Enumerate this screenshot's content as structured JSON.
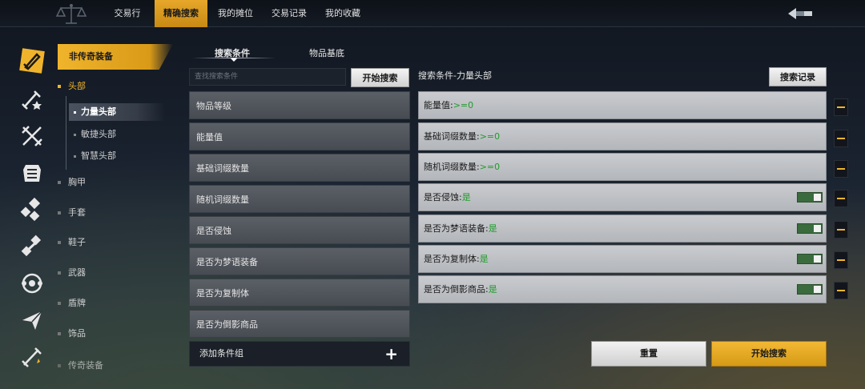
{
  "nav": {
    "tabs": [
      {
        "label": "交易行"
      },
      {
        "label": "精确搜索"
      },
      {
        "label": "我的摊位"
      },
      {
        "label": "交易记录"
      },
      {
        "label": "我的收藏"
      }
    ],
    "active_index": 1
  },
  "rail_icons": [
    "sword-shield-icon",
    "star-sword-icon",
    "crossed-swords-icon",
    "armor-icon",
    "gem-cluster-icon",
    "gem-cross-icon",
    "orb-ring-icon",
    "paper-plane-icon",
    "legendary-sword-icon"
  ],
  "categories": {
    "header": "非传奇装备",
    "items": [
      {
        "label": "头部",
        "active": true
      },
      {
        "label": "胸甲"
      },
      {
        "label": "手套"
      },
      {
        "label": "鞋子"
      },
      {
        "label": "武器"
      },
      {
        "label": "盾牌"
      },
      {
        "label": "饰品"
      },
      {
        "label": "传奇装备"
      }
    ],
    "sub_items": [
      {
        "label": "力量头部",
        "active": true
      },
      {
        "label": "敏捷头部"
      },
      {
        "label": "智慧头部"
      }
    ]
  },
  "tabs": {
    "search_conditions": "搜索条件",
    "item_base": "物品基底"
  },
  "search": {
    "placeholder": "查找搜索条件",
    "start_button": "开始搜索"
  },
  "conditions": [
    "物品等级",
    "能量值",
    "基础词缀数量",
    "随机词缀数量",
    "是否侵蚀",
    "是否为梦语装备",
    "是否为复制体",
    "是否为倒影商品"
  ],
  "add_group_label": "添加条件组",
  "right_panel": {
    "title": "搜索条件-力量头部",
    "history_button": "搜索记录",
    "criteria": [
      {
        "label": "能量值:",
        "value": ">=0",
        "toggle": false
      },
      {
        "label": "基础词缀数量:",
        "value": ">=0",
        "toggle": false
      },
      {
        "label": "随机词缀数量:",
        "value": ">=0",
        "toggle": false
      },
      {
        "label": "是否侵蚀:",
        "value": "是",
        "toggle": true
      },
      {
        "label": "是否为梦语装备:",
        "value": "是",
        "toggle": true
      },
      {
        "label": "是否为复制体:",
        "value": "是",
        "toggle": true
      },
      {
        "label": "是否为倒影商品:",
        "value": "是",
        "toggle": true
      }
    ]
  },
  "actions": {
    "reset": "重置",
    "start_search": "开始搜索"
  },
  "colors": {
    "accent": "#f0b42c",
    "value_green": "#1f9c2a",
    "toggle_on": "#3a6b3d"
  }
}
